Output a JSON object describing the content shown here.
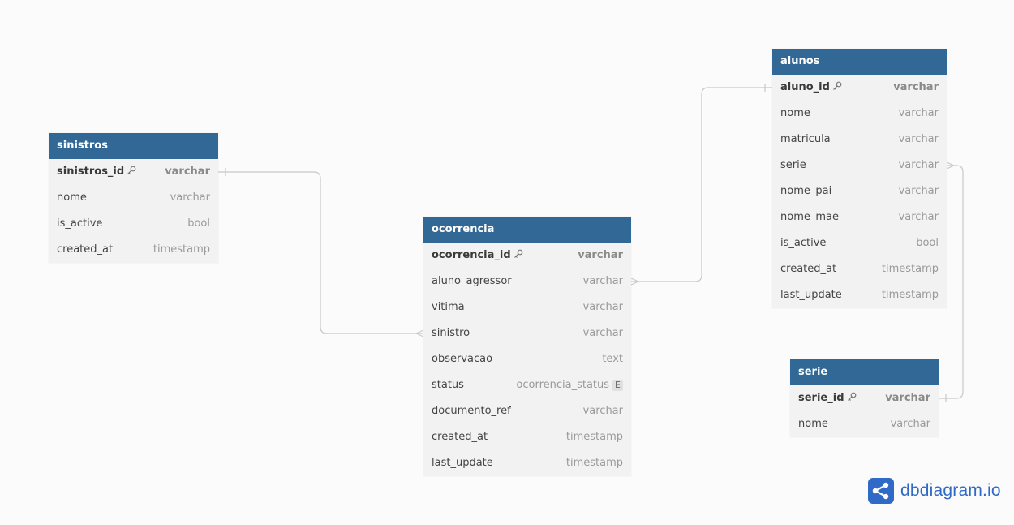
{
  "tables": [
    {
      "name": "sinistros",
      "columns": [
        {
          "name": "sinistros_id",
          "type": "varchar",
          "pk": true
        },
        {
          "name": "nome",
          "type": "varchar"
        },
        {
          "name": "is_active",
          "type": "bool"
        },
        {
          "name": "created_at",
          "type": "timestamp"
        }
      ]
    },
    {
      "name": "ocorrencia",
      "columns": [
        {
          "name": "ocorrencia_id",
          "type": "varchar",
          "pk": true
        },
        {
          "name": "aluno_agressor",
          "type": "varchar"
        },
        {
          "name": "vitima",
          "type": "varchar"
        },
        {
          "name": "sinistro",
          "type": "varchar"
        },
        {
          "name": "observacao",
          "type": "text"
        },
        {
          "name": "status",
          "type": "ocorrencia_status",
          "enum_badge": "E"
        },
        {
          "name": "documento_ref",
          "type": "varchar"
        },
        {
          "name": "created_at",
          "type": "timestamp"
        },
        {
          "name": "last_update",
          "type": "timestamp"
        }
      ]
    },
    {
      "name": "alunos",
      "columns": [
        {
          "name": "aluno_id",
          "type": "varchar",
          "pk": true
        },
        {
          "name": "nome",
          "type": "varchar"
        },
        {
          "name": "matricula",
          "type": "varchar"
        },
        {
          "name": "serie",
          "type": "varchar"
        },
        {
          "name": "nome_pai",
          "type": "varchar"
        },
        {
          "name": "nome_mae",
          "type": "varchar"
        },
        {
          "name": "is_active",
          "type": "bool"
        },
        {
          "name": "created_at",
          "type": "timestamp"
        },
        {
          "name": "last_update",
          "type": "timestamp"
        }
      ]
    },
    {
      "name": "serie",
      "columns": [
        {
          "name": "serie_id",
          "type": "varchar",
          "pk": true
        },
        {
          "name": "nome",
          "type": "varchar"
        }
      ]
    }
  ],
  "relations": [
    {
      "from": "sinistros.sinistros_id",
      "to": "ocorrencia.sinistro",
      "cardinality": "one-to-many"
    },
    {
      "from": "alunos.aluno_id",
      "to": "ocorrencia.aluno_agressor",
      "cardinality": "one-to-many"
    },
    {
      "from": "serie.serie_id",
      "to": "alunos.serie",
      "cardinality": "one-to-many"
    }
  ],
  "brand": {
    "name": "dbdiagram.io",
    "color": "#2f6ac6"
  },
  "colors": {
    "header": "#316896",
    "body": "#f2f2f2",
    "connector": "#c8c8c8"
  }
}
